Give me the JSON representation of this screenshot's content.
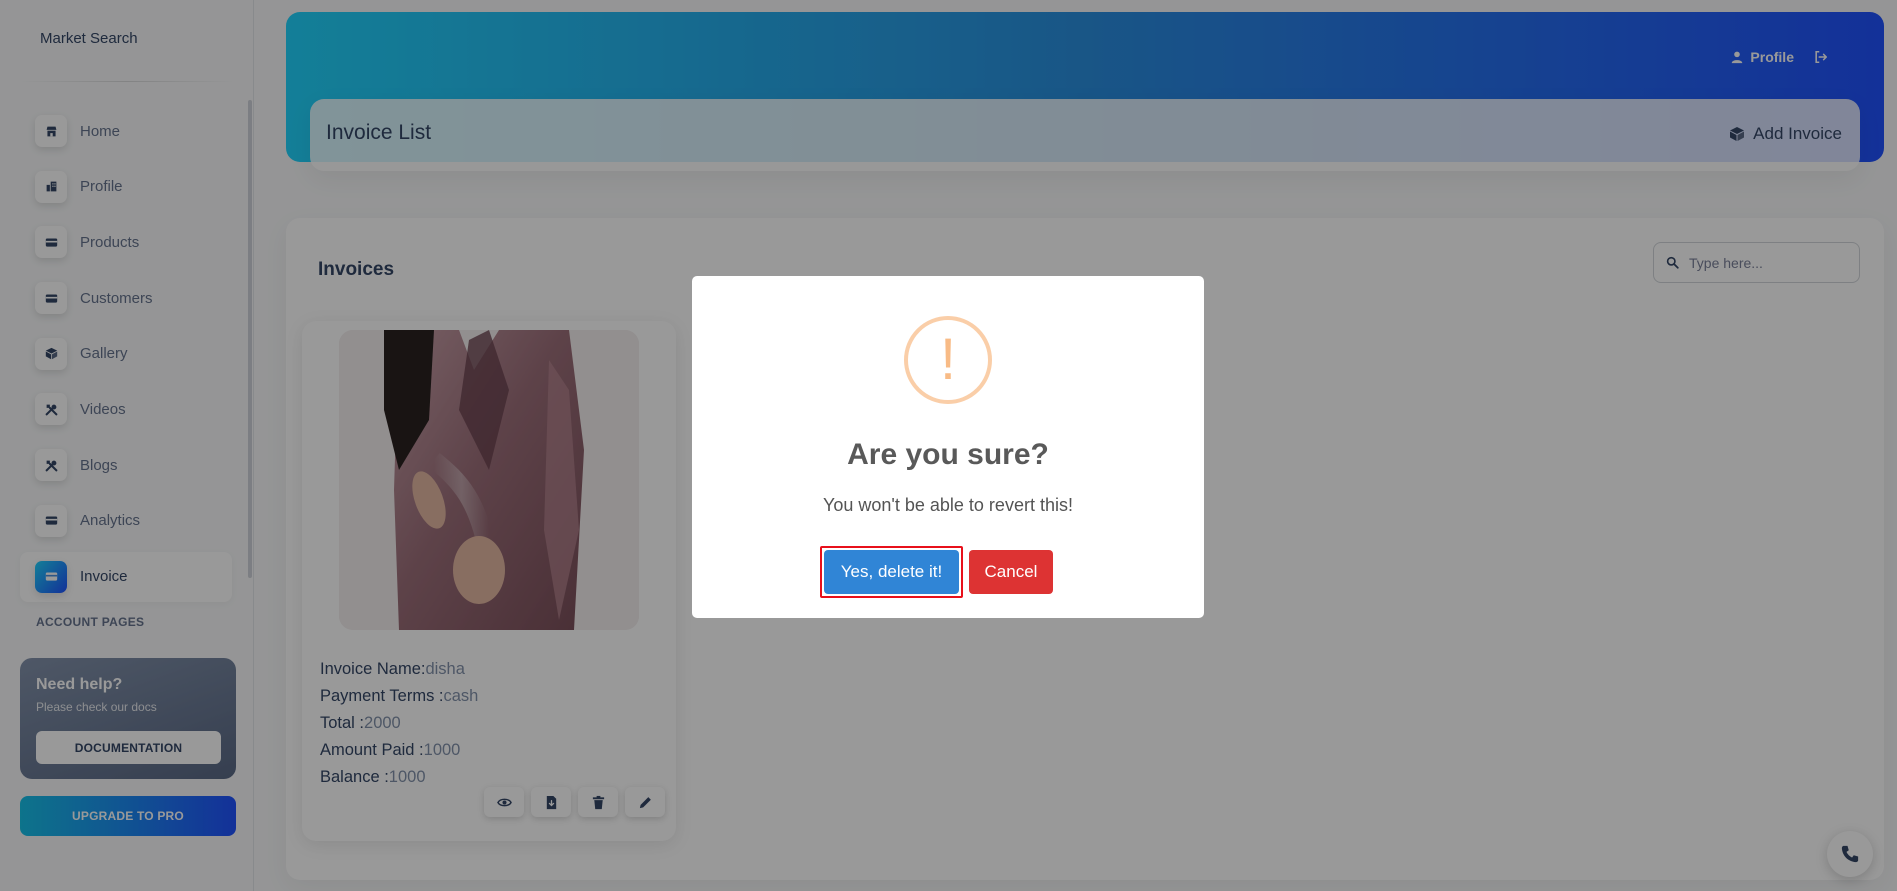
{
  "sidebar": {
    "brand": "Market Search",
    "items": [
      {
        "label": "Home",
        "icon": "shop-icon"
      },
      {
        "label": "Profile",
        "icon": "office-icon"
      },
      {
        "label": "Products",
        "icon": "credit-card-icon"
      },
      {
        "label": "Customers",
        "icon": "credit-card-icon"
      },
      {
        "label": "Gallery",
        "icon": "box-icon"
      },
      {
        "label": "Videos",
        "icon": "tools-icon"
      },
      {
        "label": "Blogs",
        "icon": "tools-icon"
      },
      {
        "label": "Analytics",
        "icon": "credit-card-icon"
      },
      {
        "label": "Invoice",
        "icon": "credit-card-icon"
      }
    ],
    "active_item": "Invoice",
    "section_title": "ACCOUNT PAGES",
    "help": {
      "title": "Need help?",
      "subtitle": "Please check our docs",
      "button": "DOCUMENTATION"
    },
    "upgrade": "UPGRADE TO PRO"
  },
  "header": {
    "profile_label": "Profile",
    "page_title": "Invoice List",
    "add_button": "Add Invoice"
  },
  "main": {
    "title": "Invoices",
    "search_placeholder": "Type here...",
    "invoice": {
      "name_label": "Invoice Name:",
      "name": "disha",
      "payment_label": "Payment Terms :",
      "payment": "cash",
      "total_label": "Total :",
      "total": "2000",
      "paid_label": "Amount Paid :",
      "paid": "1000",
      "balance_label": "Balance :",
      "balance": "1000"
    }
  },
  "modal": {
    "icon": "!",
    "title": "Are you sure?",
    "text": "You won't be able to revert this!",
    "confirm": "Yes, delete it!",
    "cancel": "Cancel"
  },
  "colors": {
    "accent": "#3085d6",
    "cancel": "#dd3333",
    "warning": "#f8bb86",
    "gradient_start": "#21d4fd",
    "gradient_end": "#2152ff"
  }
}
